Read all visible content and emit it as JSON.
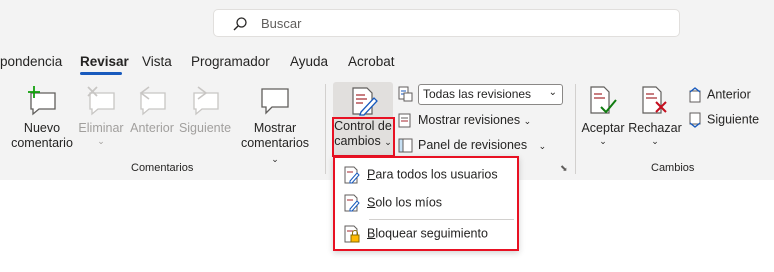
{
  "search": {
    "placeholder": "Buscar"
  },
  "tabs": [
    {
      "label": "pondencia"
    },
    {
      "label": "Revisar"
    },
    {
      "label": "Vista"
    },
    {
      "label": "Programador"
    },
    {
      "label": "Ayuda"
    },
    {
      "label": "Acrobat"
    }
  ],
  "comentarios": {
    "nuevo_l1": "Nuevo",
    "nuevo_l2": "comentario",
    "eliminar": "Eliminar",
    "anterior": "Anterior",
    "siguiente": "Siguiente",
    "mostrar_l1": "Mostrar",
    "mostrar_l2": "comentarios",
    "group_label": "Comentarios"
  },
  "seguimiento": {
    "control_l1": "Control de",
    "control_l2": "cambios",
    "combo_value": "Todas las revisiones",
    "mostrar_revisiones": "Mostrar revisiones",
    "panel_revisiones": "Panel de revisiones"
  },
  "cambios": {
    "aceptar": "Aceptar",
    "rechazar": "Rechazar",
    "anterior": "Anterior",
    "siguiente": "Siguiente",
    "group_label": "Cambios"
  },
  "dropdown": {
    "item1_hot": "P",
    "item1_rest": "ara todos los usuarios",
    "item2_hot": "S",
    "item2_rest": "olo los míos",
    "item3_hot": "B",
    "item3_rest": "loquear seguimiento"
  },
  "colors": {
    "accent": "#185abd",
    "highlight": "#e81123",
    "add_green": "#13a10e"
  }
}
